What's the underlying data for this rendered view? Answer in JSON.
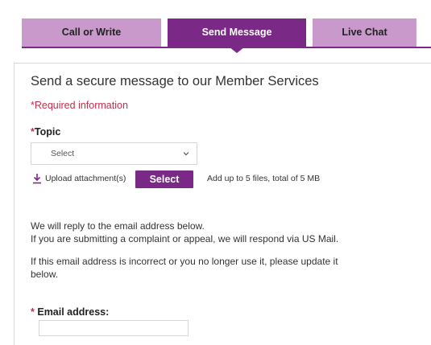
{
  "tabs": [
    {
      "label": "Call or Write",
      "active": false
    },
    {
      "label": "Send Message",
      "active": true
    },
    {
      "label": "Live Chat",
      "active": false
    }
  ],
  "form": {
    "heading": "Send a secure message to our Member Services",
    "required_note": "*Required information",
    "required_marker": "*",
    "topic_label": "Topic",
    "topic_selected": "Select",
    "upload_label": "Upload attachment(s)",
    "upload_button": "Select",
    "upload_hint": "Add up to 5 files, total of 5 MB",
    "reply_line1": "We will reply to the email address below.",
    "reply_line2": "If you are submitting a complaint or appeal, we will respond via US Mail.",
    "incorrect_note": "If this email address is incorrect or you no longer use it, please update it below.",
    "email_label": "Email address:",
    "email_value": ""
  },
  "colors": {
    "accent": "#7a2a86",
    "tab_inactive": "#c999cb",
    "required": "#c0304e"
  },
  "icons": {
    "upload": "download-arrow-icon",
    "dropdown": "chevron-down-icon"
  }
}
